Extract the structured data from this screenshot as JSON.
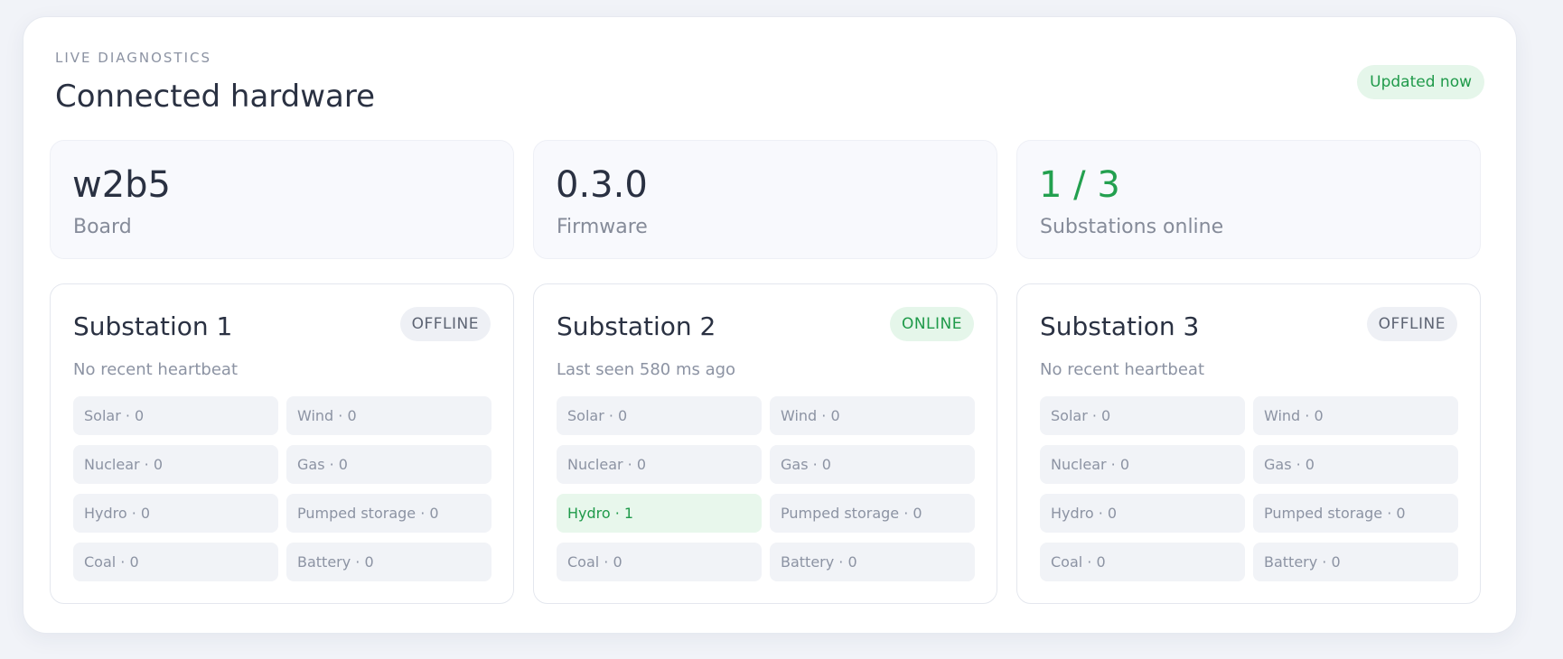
{
  "header": {
    "eyebrow": "LIVE DIAGNOSTICS",
    "title": "Connected hardware",
    "updated": "Updated now"
  },
  "stats": [
    {
      "value": "w2b5",
      "label": "Board"
    },
    {
      "value": "0.3.0",
      "label": "Firmware"
    },
    {
      "value": "1 / 3",
      "label": "Substations online"
    }
  ],
  "substations": [
    {
      "name": "Substation 1",
      "status": "OFFLINE",
      "heartbeat": "No recent heartbeat",
      "sources": [
        "Solar · 0",
        "Wind · 0",
        "Nuclear · 0",
        "Gas · 0",
        "Hydro · 0",
        "Pumped storage · 0",
        "Coal · 0",
        "Battery · 0"
      ]
    },
    {
      "name": "Substation 2",
      "status": "ONLINE",
      "heartbeat": "Last seen 580 ms ago",
      "sources": [
        "Solar · 0",
        "Wind · 0",
        "Nuclear · 0",
        "Gas · 0",
        "Hydro · 1",
        "Pumped storage · 0",
        "Coal · 0",
        "Battery · 0"
      ]
    },
    {
      "name": "Substation 3",
      "status": "OFFLINE",
      "heartbeat": "No recent heartbeat",
      "sources": [
        "Solar · 0",
        "Wind · 0",
        "Nuclear · 0",
        "Gas · 0",
        "Hydro · 0",
        "Pumped storage · 0",
        "Coal · 0",
        "Battery · 0"
      ]
    }
  ],
  "colors": {
    "accent_green": "#23a04f",
    "online_bg": "#e5f6ea",
    "offline_bg": "#eef0f5",
    "page_bg": "#f1f3f8"
  }
}
